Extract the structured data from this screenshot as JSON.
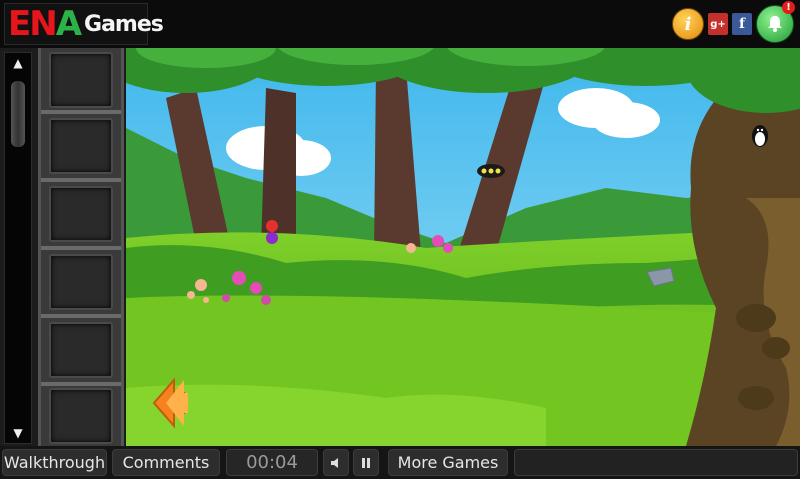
{
  "header": {
    "logo_ena": "EN",
    "logo_a": "A",
    "logo_games": "Games",
    "icons": [
      "info-icon",
      "google-plus-icon",
      "facebook-icon",
      "bell-icon"
    ],
    "info_glyph": "i",
    "gplus_glyph": "g+",
    "fb_glyph": "f",
    "badge": "!"
  },
  "inventory": {
    "scroll_up": "▲",
    "scroll_down": "▼",
    "slots": 6
  },
  "toolbar": {
    "walkthrough": "Walkthrough",
    "comments": "Comments",
    "timer": "00:04",
    "more_games": "More Games"
  },
  "colors": {
    "sky": "#5fc9f0",
    "grass": "#6bc21e",
    "accent_orange": "#f5821f"
  }
}
